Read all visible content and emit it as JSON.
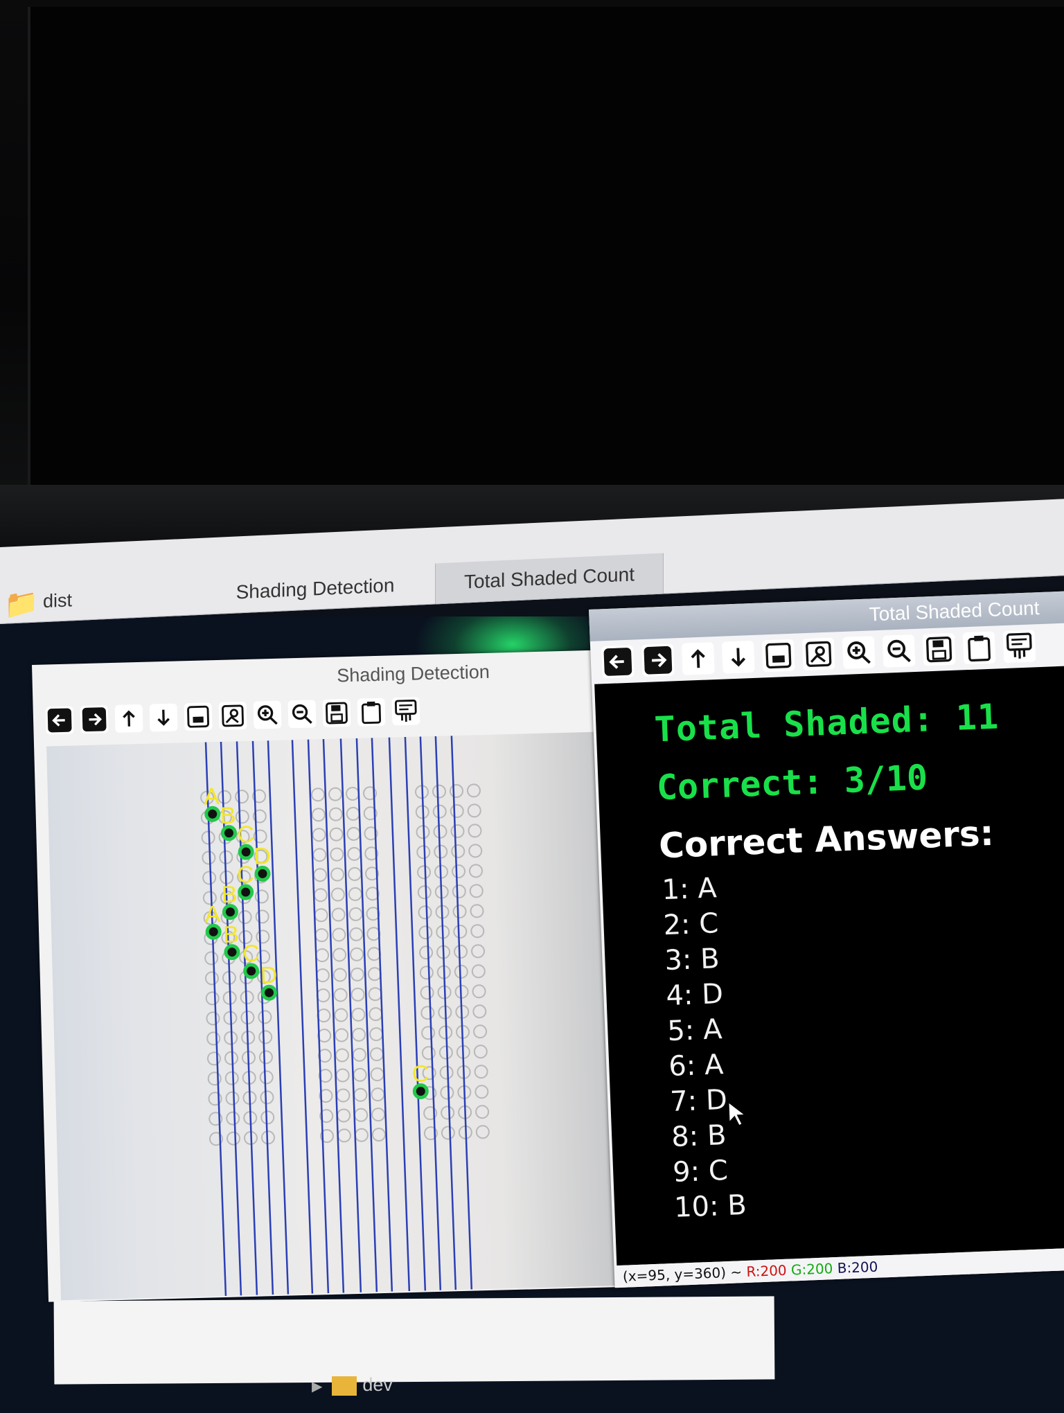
{
  "taskbar": {
    "folder_icon": "folder-icon",
    "folder_label": "dist",
    "tabs": [
      {
        "label": "Shading Detection"
      },
      {
        "label": "Total Shaded Count"
      }
    ]
  },
  "shading_window": {
    "title": "Shading Detection",
    "toolbar": [
      "pan-left-icon",
      "pan-right-icon",
      "pan-up-icon",
      "pan-down-icon",
      "fit-image-icon",
      "image-settings-icon",
      "zoom-in-icon",
      "zoom-out-icon",
      "save-icon",
      "copy-icon",
      "properties-icon"
    ],
    "markers": [
      "A",
      "B",
      "C",
      "D",
      "C",
      "B",
      "A",
      "B",
      "C",
      "D",
      "C"
    ]
  },
  "total_window": {
    "title": "Total Shaded Count",
    "toolbar": [
      "pan-left-icon",
      "pan-right-icon",
      "pan-up-icon",
      "pan-down-icon",
      "fit-image-icon",
      "image-settings-icon",
      "zoom-in-icon",
      "zoom-out-icon",
      "save-icon",
      "copy-icon",
      "properties-icon"
    ],
    "total_shaded": "Total Shaded: 11",
    "correct": "Correct: 3/10",
    "answers_heading": "Correct Answers:",
    "answers": [
      "1: A",
      "2: C",
      "3: B",
      "4: D",
      "5: A",
      "6: A",
      "7: D",
      "8: B",
      "9: C",
      "10: B"
    ],
    "status": {
      "coords": "(x=95, y=360) ~ ",
      "r": "R:200",
      "g": "G:200",
      "b": "B:200"
    },
    "text_color_green": "#19e04a"
  },
  "bottom": {
    "folder_label": "dev"
  }
}
